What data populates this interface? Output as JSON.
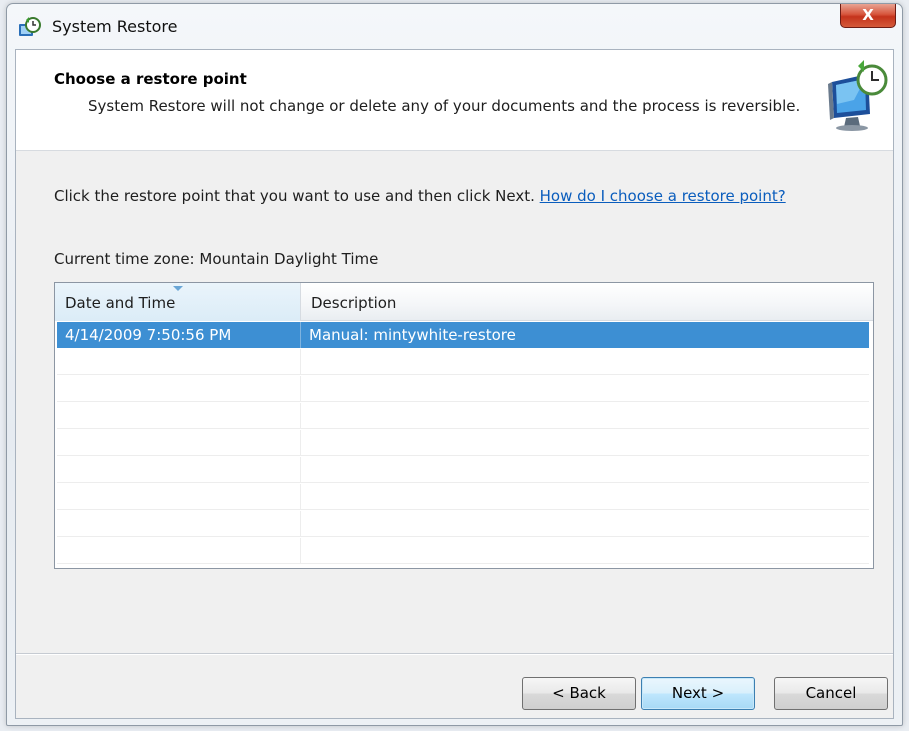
{
  "window": {
    "title": "System Restore",
    "close_label": "X"
  },
  "header": {
    "title": "Choose a restore point",
    "subtitle": "System Restore will not change or delete any of your documents and the process is reversible."
  },
  "instruction": {
    "text": "Click the restore point that you want to use and then click Next. ",
    "link": "How do I choose a restore point?"
  },
  "timezone": "Current time zone: Mountain Daylight Time",
  "table": {
    "columns": [
      "Date and Time",
      "Description"
    ],
    "rows": [
      {
        "date": "4/14/2009 7:50:56 PM",
        "description": "Manual: mintywhite-restore"
      }
    ]
  },
  "buttons": {
    "back": "< Back",
    "next": "Next >",
    "cancel": "Cancel"
  },
  "icons": {
    "app": "system-restore-icon",
    "header": "restore-monitor-clock-icon"
  },
  "colors": {
    "selection": "#3d8fd3",
    "link": "#0a5dbd",
    "close": "#c4331c"
  }
}
